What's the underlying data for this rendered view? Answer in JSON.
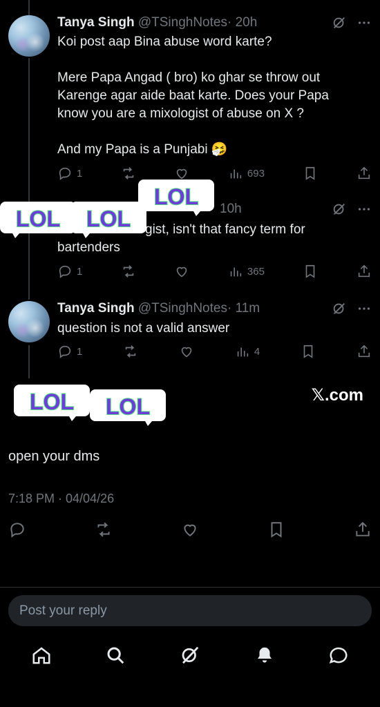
{
  "posts": [
    {
      "name": "Tanya Singh",
      "handle": "@TSinghNotes",
      "time": "· 20h",
      "lines": [
        "Koi post aap Bina abuse word karte?",
        "",
        "Mere Papa Angad ( bro) ko ghar se throw out",
        "Karenge agar aide baat karte. Does your Papa",
        "know you are a mixologist of abuse on X ?",
        "",
        "And my Papa is a Punjabi 🤧"
      ],
      "replies": "1",
      "views": "693"
    },
    {
      "time": "10h",
      "lines": [
        "gist, isn't that fancy term for",
        "bartenders"
      ],
      "replies": "1",
      "views": "365"
    },
    {
      "name": "Tanya Singh",
      "handle": "@TSinghNotes",
      "time": "· 11m",
      "lines": [
        "question is not a valid answer"
      ],
      "replies": "1",
      "views": "4"
    }
  ],
  "lol_sticker_text": "LOL",
  "brand": "𝕏.com",
  "main_post": {
    "text": "open your dms",
    "timestamp": "7:18 PM · 04/04/26"
  },
  "reply_placeholder": "Post your reply",
  "icons": {
    "grok": "grok-icon",
    "more": "more-icon",
    "reply": "reply-icon",
    "repost": "repost-icon",
    "like": "like-icon",
    "views": "views-icon",
    "bookmark": "bookmark-icon",
    "share": "share-icon",
    "home": "home-icon",
    "search": "search-icon",
    "notifications": "bell-icon",
    "messages": "messages-icon"
  },
  "colors": {
    "background": "#000000",
    "text": "#e7e9ea",
    "muted": "#71767b",
    "sticker_purple": "#8b5cf6",
    "sticker_green": "#5ee08a"
  }
}
